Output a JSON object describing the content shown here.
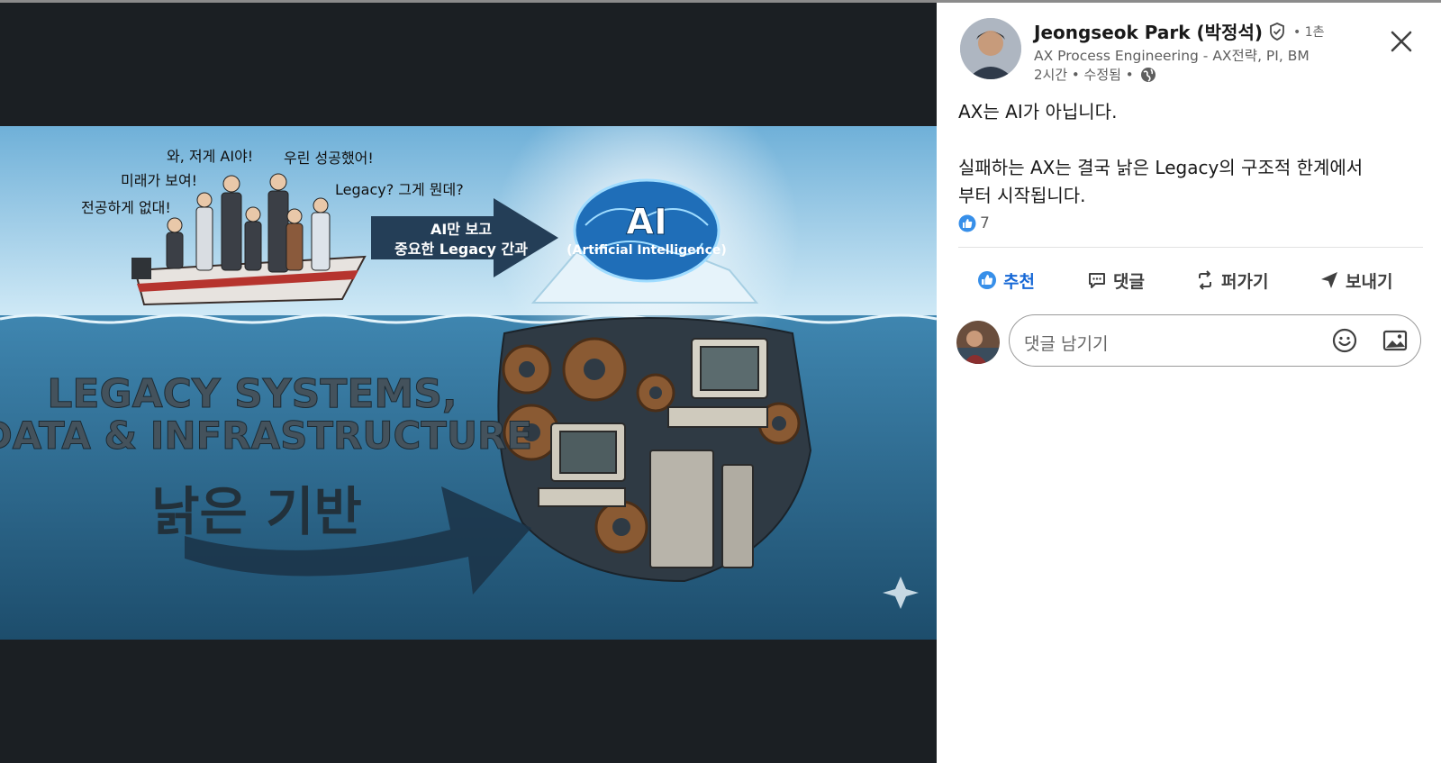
{
  "image": {
    "alt_hidden": "",
    "callouts": [
      "와, 저게 AI야!",
      "우린 성공했어!",
      "미래가 보여!",
      "전공하게 없대!",
      "Legacy? 그게 뭔데?"
    ],
    "arrow_text": [
      "AI만 보고",
      "중요한 Legacy 간과"
    ],
    "brain_title": "AI",
    "brain_subtitle": "(Artificial Intelligence)",
    "headline_lines": [
      "LEGACY SYSTEMS,",
      "DATA & INFRASTRUCTURE"
    ],
    "korean_tagline": "낡은 기반"
  },
  "author": {
    "name": "Jeongseok Park (박정석)",
    "degree": "• 1촌",
    "headline": "AX Process Engineering - AX전략, PI, BM",
    "time": "2시간 • 수정됨 •"
  },
  "post": {
    "line1": "AX는 AI가 아닙니다.",
    "line2": "실패하는 AX는 결국 낡은 Legacy의 구조적 한계에서",
    "line3": "부터 시작됩니다."
  },
  "reactions": {
    "count": "7"
  },
  "actions": {
    "like": "추천",
    "comment": "댓글",
    "repost": "퍼가기",
    "send": "보내기"
  },
  "comment": {
    "placeholder": "댓글 남기기"
  },
  "colors": {
    "accent": "#1768d6",
    "media_bg": "#1b1f23",
    "panel_bg": "#ffffff"
  }
}
